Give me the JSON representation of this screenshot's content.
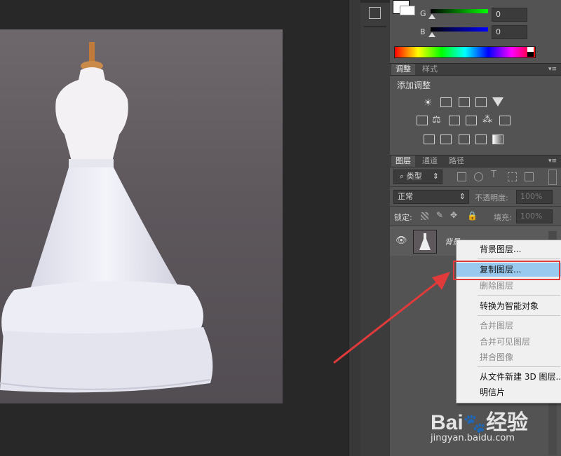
{
  "color_panel": {
    "g_label": "G",
    "g_value": "0",
    "b_label": "B",
    "b_value": "0"
  },
  "adjustments": {
    "tabs": [
      "调整",
      "样式"
    ],
    "title": "添加调整"
  },
  "layers": {
    "tabs": [
      "图层",
      "通道",
      "路径"
    ],
    "filter_label": "类型",
    "blend_mode": "正常",
    "opacity_label": "不透明度:",
    "opacity_value": "100%",
    "lock_label": "锁定:",
    "fill_label": "填充:",
    "fill_value": "100%",
    "layer_name_partial": "背景"
  },
  "context_menu": {
    "items": [
      {
        "label": "背景图层...",
        "state": "normal"
      },
      {
        "label": "复制图层...",
        "state": "highlighted"
      },
      {
        "label": "删除图层",
        "state": "disabled"
      },
      {
        "label": "转换为智能对象",
        "state": "normal"
      },
      {
        "label": "合并图层",
        "state": "disabled"
      },
      {
        "label": "合并可见图层",
        "state": "disabled"
      },
      {
        "label": "拼合图像",
        "state": "disabled"
      },
      {
        "label": "从文件新建 3D 图层...",
        "state": "normal"
      },
      {
        "label": "明信片",
        "state": "normal"
      }
    ]
  },
  "watermark": {
    "brand": "Bai",
    "brand2": "经验",
    "url": "jingyan.baidu.com"
  },
  "colors": {
    "annotation_red": "#e03a3a",
    "menu_highlight": "#99c9ef",
    "panel_bg": "#535353"
  }
}
